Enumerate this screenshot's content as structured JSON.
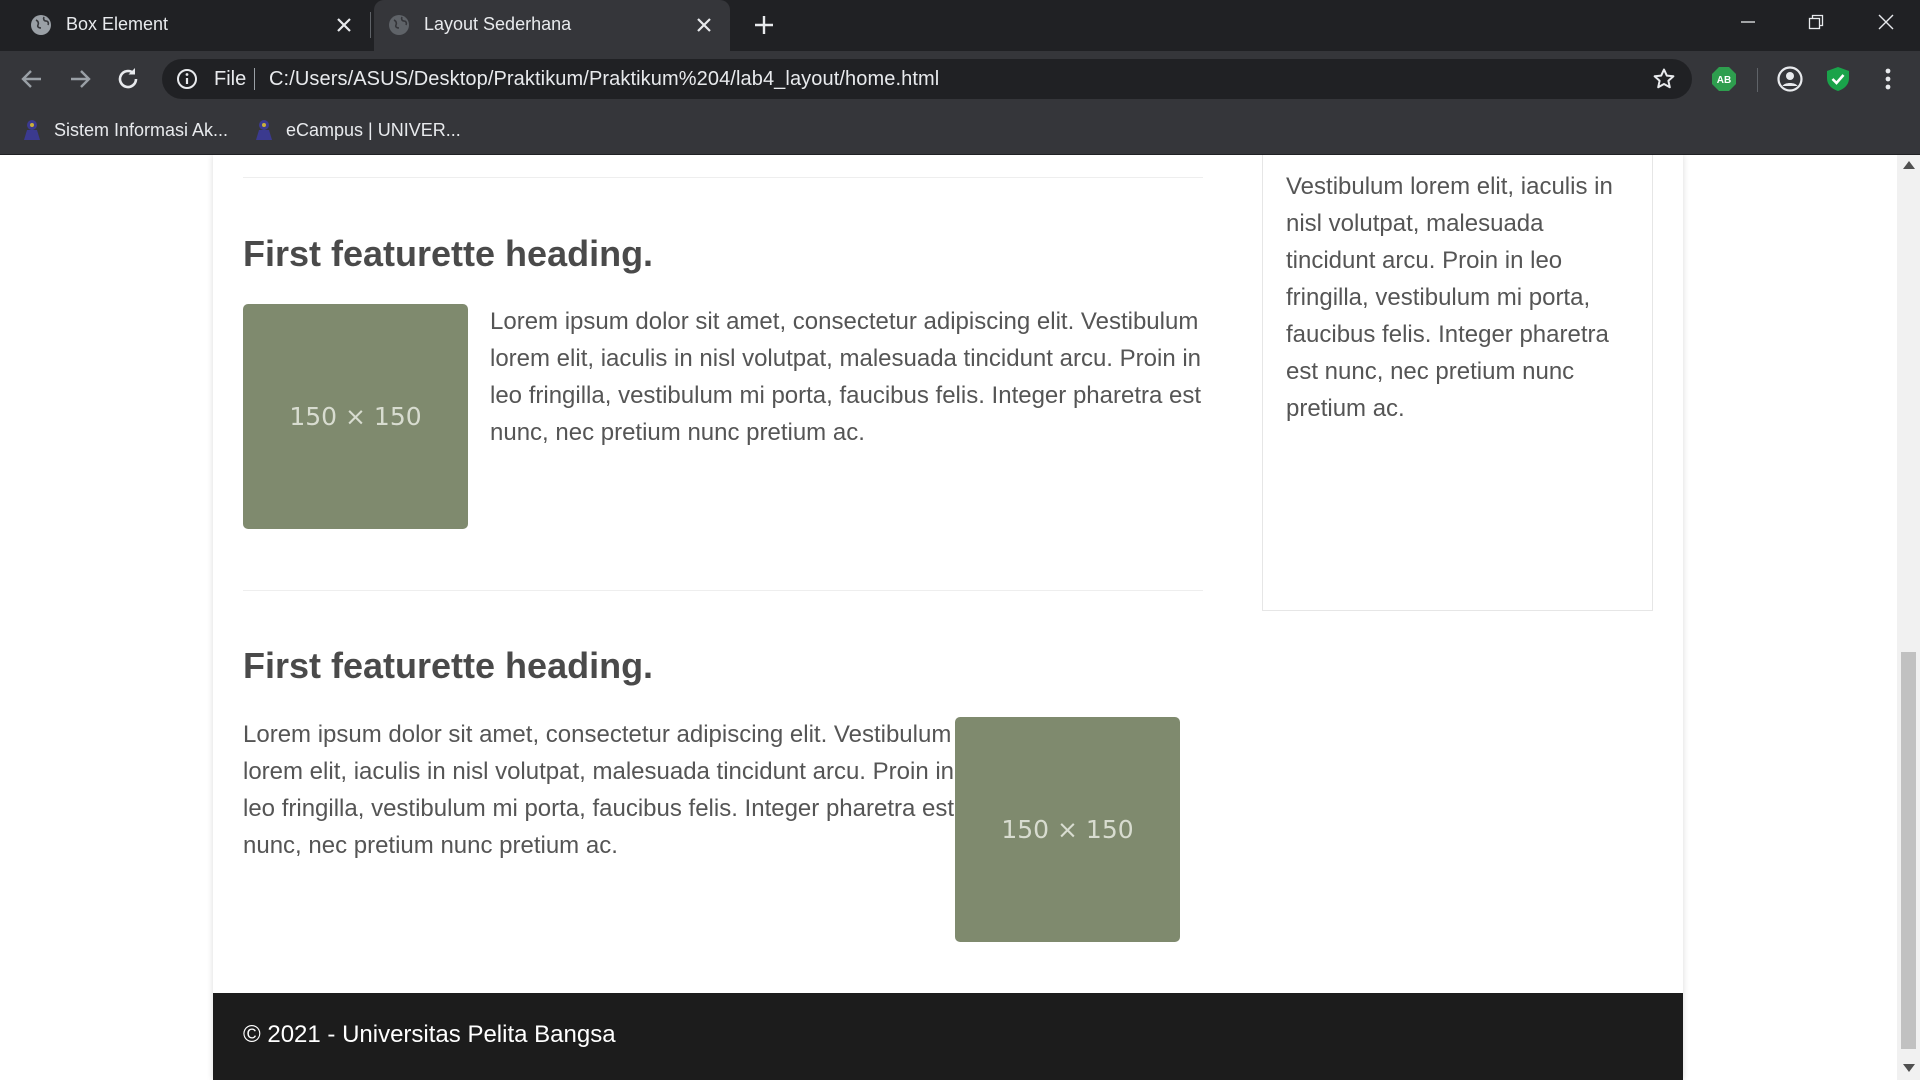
{
  "browser": {
    "tabs": [
      {
        "title": "Box Element",
        "active": false
      },
      {
        "title": "Layout Sederhana",
        "active": true
      }
    ],
    "address": {
      "scheme_label": "File",
      "url": "C:/Users/ASUS/Desktop/Praktikum/Praktikum%204/lab4_layout/home.html"
    },
    "bookmarks": [
      {
        "label": "Sistem Informasi Ak..."
      },
      {
        "label": "eCampus | UNIVER..."
      }
    ],
    "extensions": [
      {
        "name": "adblock-icon",
        "text": "AB",
        "color": "#2e9e4e"
      },
      {
        "name": "profile-icon"
      },
      {
        "name": "shield-check-icon",
        "color": "#1aa34a"
      }
    ]
  },
  "page": {
    "featurettes": [
      {
        "heading": "First featurette heading.",
        "image_label": "150 × 150",
        "image_position": "left",
        "text": "Lorem ipsum dolor sit amet, consectetur adipiscing elit. Vestibulum lorem elit, iaculis in nisl volutpat, malesuada tincidunt arcu. Proin in leo fringilla, vestibulum mi porta, faucibus felis. Integer pharetra est nunc, nec pretium nunc pretium ac."
      },
      {
        "heading": "First featurette heading.",
        "image_label": "150 × 150",
        "image_position": "right",
        "text": "Lorem ipsum dolor sit amet, consectetur adipiscing elit. Vestibulum lorem elit, iaculis in nisl volutpat, malesuada tincidunt arcu. Proin in leo fringilla, vestibulum mi porta, faucibus felis. Integer pharetra est nunc, nec pretium nunc pretium ac."
      }
    ],
    "sidebar": {
      "text": "Vestibulum lorem elit, iaculis in nisl volutpat, malesuada tincidunt arcu. Proin in leo fringilla, vestibulum mi porta, faucibus felis. Integer pharetra est nunc, nec pretium nunc pretium ac."
    },
    "footer": {
      "text": "© 2021 - Universitas Pelita Bangsa"
    },
    "colors": {
      "placeholder": "#7f8a6e",
      "footer_bg": "#1c1c1c",
      "chrome_dark": "#202124",
      "chrome_mid": "#35363a"
    }
  }
}
